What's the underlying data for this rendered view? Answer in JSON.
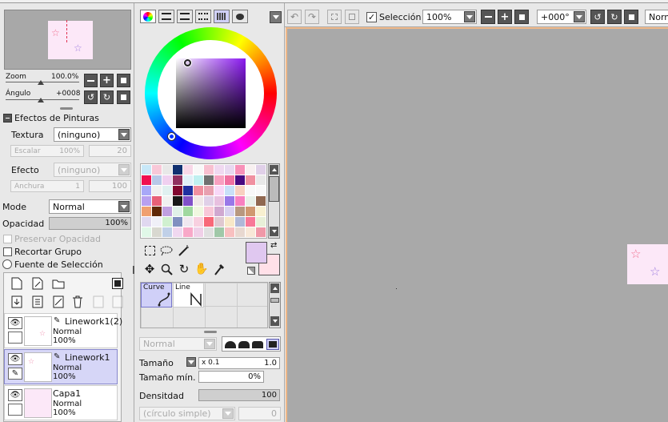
{
  "navigator": {
    "zoom_label": "Zoom",
    "zoom_value": "100.0%",
    "angle_label": "Ángulo",
    "angle_value": "+0008"
  },
  "paint_effects": {
    "title": "Efectos de Pinturas",
    "texture_label": "Textura",
    "texture_value": "(ninguno)",
    "scale_label": "Escalar",
    "scale_value": "100%",
    "scale_num": "20",
    "effect_label": "Efecto",
    "effect_value": "(ninguno)",
    "width_label": "Anchura",
    "width_value": "1",
    "width_num": "100"
  },
  "layer_props": {
    "mode_label": "Mode",
    "mode_value": "Normal",
    "opacity_label": "Opacidad",
    "opacity_value": "100%",
    "opacity_level": 1.0,
    "preserve_opacity": "Preservar Opacidad",
    "clip_group": "Recortar Grupo",
    "selection_source": "Fuente de Selección"
  },
  "layers": [
    {
      "name": "Linework1(2)",
      "mode": "Normal",
      "opacity": "100%",
      "selected": false
    },
    {
      "name": "Linework1",
      "mode": "Normal",
      "opacity": "100%",
      "selected": true
    },
    {
      "name": "Capa1",
      "mode": "Normal",
      "opacity": "100%",
      "selected": false
    }
  ],
  "color": {
    "main": "#e0c8f0",
    "sub": "#ffe0e8"
  },
  "palette": [
    "#c8e8f8",
    "#f8c8d8",
    "#e8e8e8",
    "#103070",
    "#f8d8e8",
    "#f8f8f8",
    "#f8c0d0",
    "#f0d8f0",
    "#e8d8f0",
    "#f890b8",
    "#f8f0f0",
    "#e0d0e8",
    "#f01050",
    "#b8c8e8",
    "#f0d0f0",
    "#903060",
    "#e0f0f8",
    "#c0f0f0",
    "#707070",
    "#f8a0c0",
    "#f070a0",
    "#480880",
    "#f090a0",
    "#e8e8e8",
    "#a8a8f8",
    "#f0f0f0",
    "#e0f0f0",
    "#800830",
    "#2030a0",
    "#f090a0",
    "#e8a0b0",
    "#f8d8f8",
    "#c8e0f8",
    "#f8d0c0",
    "#f8f8f8",
    "#f8f8f8",
    "#b8a0f0",
    "#e86078",
    "#f0f0f0",
    "#181818",
    "#8050c8",
    "#f0e8e8",
    "#e0d0e8",
    "#e8c0e0",
    "#9878e8",
    "#f880c0",
    "#e8f0e8",
    "#906850",
    "#f0a070",
    "#602808",
    "#c0a0e0",
    "#e0f0e8",
    "#a0d8a0",
    "#f0f8e0",
    "#f8c8d8",
    "#d0a8d0",
    "#d8d0f0",
    "#b89880",
    "#d09870",
    "#f8f0d0",
    "#e0d8f0",
    "#f0f0f8",
    "#d0f0d0",
    "#8090c0",
    "#f0e8f0",
    "#f8d0e0",
    "#f86878",
    "#e0c8d0",
    "#f8e8c8",
    "#b0b8d8",
    "#f87898",
    "#e8f0d8",
    "#e0f8e8",
    "#d8d8d0",
    "#c0d0e8",
    "#f0d8f0",
    "#f8a8c8",
    "#f0d0e8",
    "#e0e0e0",
    "#a0c8a8",
    "#f8c0c0",
    "#e8d8d0",
    "#f8e8d8",
    "#f098a8",
    "#f8f8c8",
    "#e0e0f0",
    "#f0b8c8",
    "#d8d0f8",
    "#e8d0e8",
    "#f8d0d8",
    "#c0c0c0",
    "#e0c0f0",
    "#f8b8d0",
    "#e0e0f0",
    "#ffffff",
    "#f8e8f0",
    "#f8f8f8",
    "#f0f8f0",
    "#f0c0f0",
    "#f8f8f8",
    "#e8d0e8",
    "#b0b8e8",
    "#f8f0e0",
    "#f8f8f8",
    "#c0b8e8",
    "#d8d8d8",
    "#f0c8d8",
    "#f8d8e8",
    "#f8e8f8",
    "#f8f8a0",
    "#f0f8f0",
    "#f0d0a0",
    "#f8b8d8",
    "#e8c8f0",
    "#d8d8f0",
    "#f8f8f8",
    "#e8f8f8",
    "#d8e0f8",
    "#f890b0",
    "#f8e0f0",
    "#d8d8e8",
    "#ffff00",
    "#f8f8f8",
    "#e0d0f8",
    "#f0d8f0",
    "#f0a0c0",
    "#f8c8d8",
    "#f8b8c8",
    "#d0d0f0",
    "#e8e8f0",
    "#f0f0f0",
    "#e8e8e8",
    "#e8e8e8",
    "#ffffff"
  ],
  "tools": {
    "curve_label": "Curve",
    "line_label": "Line"
  },
  "brush": {
    "blend_value": "Normal",
    "size_label": "Tamaño",
    "size_mult": "x 0.1",
    "size_value": "1.0",
    "min_size_label": "Tamaño mín.",
    "min_size_value": "0%",
    "density_label": "Densitdad",
    "density_value": "100",
    "density_level": 1.0,
    "shape_value": "(círculo simple)",
    "shape_num": "0"
  },
  "toolbar": {
    "selection_label": "Selección",
    "zoom_value": "100%",
    "rotate_value": "+000°",
    "blend_value": "Norma"
  }
}
